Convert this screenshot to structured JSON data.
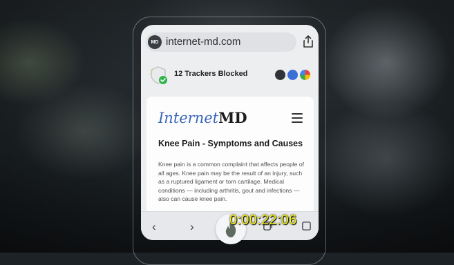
{
  "browser": {
    "site_badge": "MD",
    "url": "internet-md.com",
    "share_icon": "share-icon"
  },
  "trackers": {
    "label": "12 Trackers Blocked",
    "shield_icon": "shield-check-icon",
    "tracker_icons": [
      "tracker-icon",
      "facebook-icon",
      "google-icon"
    ]
  },
  "page": {
    "logo_part1": "Internet",
    "logo_part2": "MD",
    "menu_icon": "hamburger-menu-icon",
    "title": "Knee Pain - Symptoms and Causes",
    "body": "Knee pain is a common complaint that affects people of all ages. Knee pain may be the result of an injury, such as a ruptured ligament or torn cartilage. Medical conditions — including arthritis, gout and infections — also can cause knee pain."
  },
  "toolbar": {
    "back_glyph": "‹",
    "forward_glyph": "›",
    "tabs_icon": "tabs-icon",
    "more_icon": "more-icon"
  },
  "overlay": {
    "timestamp": "0:00:22:06"
  },
  "colors": {
    "logo_blue": "#3a66b8",
    "shield_green": "#2fb34a",
    "timestamp_yellow": "#f2ef12"
  }
}
